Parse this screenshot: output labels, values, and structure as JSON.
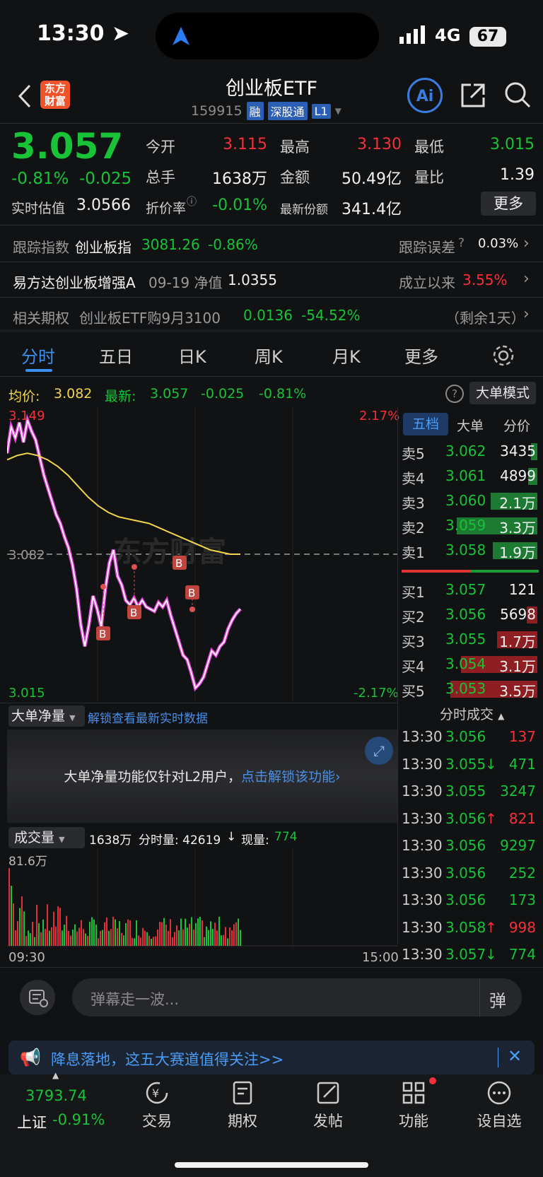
{
  "status": {
    "time": "13:30",
    "network": "4G",
    "battery": "67"
  },
  "header": {
    "logo_line1": "东方",
    "logo_line2": "财富",
    "title": "创业板ETF",
    "code": "159915",
    "tags": [
      "融",
      "深股通",
      "L1"
    ],
    "ai": "Ai"
  },
  "quote": {
    "price": "3.057",
    "change_pct": "-0.81%",
    "change": "-0.025",
    "open_label": "今开",
    "open": "3.115",
    "high_label": "最高",
    "high": "3.130",
    "low_label": "最低",
    "low": "3.015",
    "volume_label": "总手",
    "volume": "1638万",
    "amount_label": "金额",
    "amount": "50.49亿",
    "ratio_label": "量比",
    "ratio": "1.39",
    "est_label": "实时估值",
    "est": "3.0566",
    "premium_label": "折价率",
    "premium": "-0.01%",
    "shares_label": "最新份额",
    "shares": "341.4亿",
    "more": "更多"
  },
  "info_rows": {
    "track_label": "跟踪指数",
    "track_name": "创业板指",
    "track_value": "3081.26",
    "track_pct": "-0.86%",
    "error_label": "跟踪误差",
    "error_value": "0.03%",
    "fund_name": "易方达创业板增强A",
    "fund_date": "09-19 净值",
    "fund_nav": "1.0355",
    "since_label": "成立以来",
    "since_value": "3.55%",
    "opt_label": "相关期权",
    "opt_name": "创业板ETF购9月3100",
    "opt_price": "0.0136",
    "opt_pct": "-54.52%",
    "opt_remain": "（剩余1天）"
  },
  "tabs": [
    "分时",
    "五日",
    "日K",
    "周K",
    "月K",
    "更多"
  ],
  "chart_header": {
    "avg_label": "均价:",
    "avg": "3.082",
    "last_label": "最新:",
    "last": "3.057",
    "chg": "-0.025",
    "pct": "-0.81%",
    "mode": "大单模式"
  },
  "chart_data": {
    "type": "line",
    "ylim": [
      3.015,
      3.149
    ],
    "y_tick_labels": [
      "3.149",
      "3.082",
      "3.015"
    ],
    "pct_tick_labels": [
      "2.17%",
      "-2.17%"
    ],
    "x_tick_labels": [
      "09:30",
      "15:00"
    ],
    "series": [
      {
        "values": [
          3.128,
          3.14,
          3.135,
          3.142,
          3.133,
          3.143,
          3.138,
          3.134,
          3.126,
          3.118,
          3.112,
          3.106,
          3.1,
          3.096,
          3.09,
          3.085,
          3.077,
          3.066,
          3.05,
          3.04,
          3.05,
          3.063,
          3.057,
          3.049,
          3.066,
          3.078,
          3.084,
          3.072,
          3.068,
          3.061,
          3.059,
          3.062,
          3.058,
          3.061,
          3.058,
          3.057,
          3.056,
          3.06,
          3.058,
          3.061,
          3.054,
          3.048,
          3.042,
          3.036,
          3.034,
          3.028,
          3.021,
          3.023,
          3.026,
          3.032,
          3.038,
          3.036,
          3.04,
          3.042,
          3.048,
          3.052,
          3.055,
          3.057
        ]
      },
      {
        "values": [
          3.125,
          3.127,
          3.128,
          3.127,
          3.125,
          3.122,
          3.118,
          3.113,
          3.108,
          3.104,
          3.101,
          3.099,
          3.098,
          3.097,
          3.096,
          3.094,
          3.092,
          3.09,
          3.088,
          3.086,
          3.084,
          3.083,
          3.082,
          3.082
        ]
      }
    ],
    "markers": [
      "B",
      "B",
      "B",
      "B"
    ],
    "volume_max_label": "81.6万"
  },
  "order_book": {
    "tabs": [
      "五档",
      "大单",
      "分价"
    ],
    "asks": [
      {
        "label": "卖5",
        "price": "3.062",
        "vol": "3435",
        "w": 0.05
      },
      {
        "label": "卖4",
        "price": "3.061",
        "vol": "4899",
        "w": 0.07
      },
      {
        "label": "卖3",
        "price": "3.060",
        "vol": "2.1万",
        "w": 0.35
      },
      {
        "label": "卖2",
        "price": "3.059",
        "vol": "3.3万",
        "w": 0.6
      },
      {
        "label": "卖1",
        "price": "3.058",
        "vol": "1.9万",
        "w": 0.33
      }
    ],
    "bids": [
      {
        "label": "买1",
        "price": "3.057",
        "vol": "121",
        "w": 0.0
      },
      {
        "label": "买2",
        "price": "3.056",
        "vol": "5698",
        "w": 0.08
      },
      {
        "label": "买3",
        "price": "3.055",
        "vol": "1.7万",
        "w": 0.3
      },
      {
        "label": "买4",
        "price": "3.054",
        "vol": "3.1万",
        "w": 0.57
      },
      {
        "label": "买5",
        "price": "3.053",
        "vol": "3.5万",
        "w": 0.65
      }
    ]
  },
  "big_order": {
    "label": "大单净量",
    "link": "解锁查看最新实时数据",
    "notice": "大单净量功能仅针对L2用户，",
    "unlock": "点击解锁该功能"
  },
  "volume_bar": {
    "label": "成交量",
    "total": "1638万",
    "min_label": "分时量: 42619",
    "arrow": "↓",
    "now_label": "现量:",
    "now": "774"
  },
  "ticks_title": "分时成交",
  "ticks": [
    {
      "t": "13:30",
      "p": "3.056",
      "a": "",
      "v": "137",
      "c": "red"
    },
    {
      "t": "13:30",
      "p": "3.055",
      "a": "↓",
      "v": "471",
      "c": "green"
    },
    {
      "t": "13:30",
      "p": "3.055",
      "a": "",
      "v": "3247",
      "c": "green"
    },
    {
      "t": "13:30",
      "p": "3.056",
      "a": "↑",
      "v": "821",
      "c": "red"
    },
    {
      "t": "13:30",
      "p": "3.056",
      "a": "",
      "v": "9297",
      "c": "green"
    },
    {
      "t": "13:30",
      "p": "3.056",
      "a": "",
      "v": "252",
      "c": "green"
    },
    {
      "t": "13:30",
      "p": "3.056",
      "a": "",
      "v": "173",
      "c": "green"
    },
    {
      "t": "13:30",
      "p": "3.058",
      "a": "↑",
      "v": "998",
      "c": "red"
    },
    {
      "t": "13:30",
      "p": "3.057",
      "a": "↓",
      "v": "774",
      "c": "green"
    }
  ],
  "comment": {
    "placeholder": "弹幕走一波...",
    "danmu": "弹"
  },
  "banner": {
    "text": "降息落地，这五大赛道值得关注>>"
  },
  "nav": {
    "index_value": "3793.74",
    "index_name": "上证",
    "index_pct": "-0.91%",
    "items": [
      "交易",
      "期权",
      "发帖",
      "功能",
      "设自选"
    ]
  }
}
